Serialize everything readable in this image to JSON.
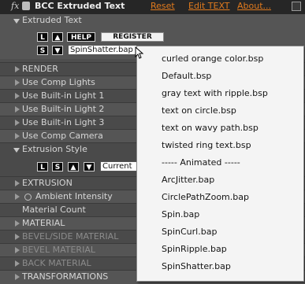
{
  "header": {
    "fx": "fx",
    "title": "BCC Extruded Text",
    "reset": "Reset",
    "edit_text": "Edit TEXT",
    "about": "About..."
  },
  "extruded_text": {
    "label": "Extruded Text",
    "buttons": {
      "l": "L",
      "up": "▲",
      "help": "HELP",
      "register": "REGISTER",
      "s": "S",
      "down": "▼"
    },
    "preset_value": "SpinShatter.bap"
  },
  "render": {
    "label": "RENDER",
    "items": [
      "Use Comp Lights",
      "Use Built-in Light 1",
      "Use Built-in Light 2",
      "Use Built-in Light 3",
      "Use Comp Camera"
    ]
  },
  "extrusion_style": {
    "label": "Extrusion Style",
    "buttons": {
      "l": "L",
      "s": "S",
      "up": "▲",
      "down": "▼"
    },
    "value": "Current"
  },
  "sections": {
    "extrusion": "EXTRUSION",
    "ambient_intensity": "Ambient Intensity",
    "material_count": "Material Count",
    "material": "MATERIAL",
    "bevel_side_material": "BEVEL/SIDE MATERIAL",
    "bevel_material": "BEVEL MATERIAL",
    "back_material": "BACK MATERIAL",
    "transformations": "TRANSFORMATIONS"
  },
  "popup": {
    "items": [
      "curled orange color.bsp",
      "Default.bsp",
      "gray text with ripple.bsp",
      "text on circle.bsp",
      "text on wavy path.bsp",
      "twisted ring text.bsp",
      "----- Animated -----",
      "ArcJitter.bap",
      "CirclePathZoom.bap",
      "Spin.bap",
      "SpinCurl.bap",
      "SpinRipple.bap",
      "SpinShatter.bap"
    ]
  },
  "colors": {
    "accent_link": "#e07a1e",
    "panel": "#4e4e4e",
    "header": "#262626",
    "popup_bg": "#f4f4f4"
  }
}
